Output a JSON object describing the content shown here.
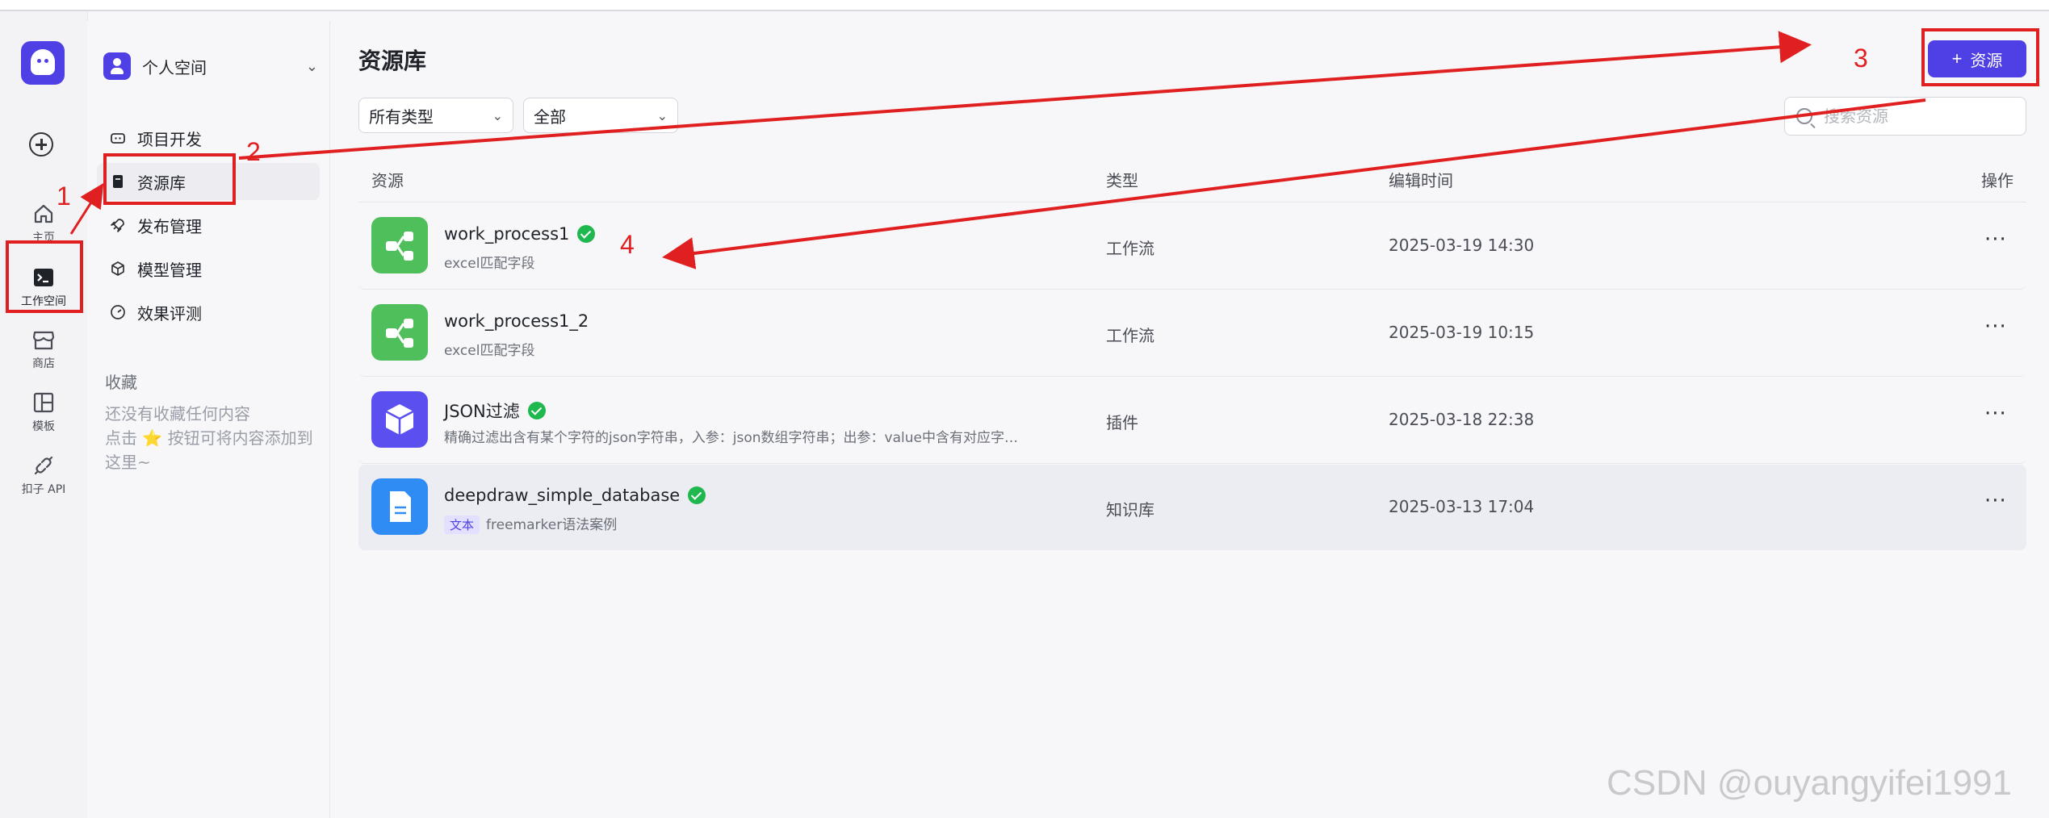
{
  "rail": {
    "home": "主页",
    "workspace": "工作空间",
    "store": "商店",
    "templates": "模板",
    "api": "扣子 API"
  },
  "sidebar": {
    "space_name": "个人空间",
    "items": [
      {
        "label": "项目开发",
        "icon": "robot-icon"
      },
      {
        "label": "资源库",
        "icon": "book-icon"
      },
      {
        "label": "发布管理",
        "icon": "rocket-icon"
      },
      {
        "label": "模型管理",
        "icon": "cube-icon"
      },
      {
        "label": "效果评测",
        "icon": "gauge-icon"
      }
    ],
    "favorites_title": "收藏",
    "favorites_empty_line1": "还没有收藏任何内容",
    "favorites_empty_line2": "点击 ⭐ 按钮可将内容添加到这里~"
  },
  "main": {
    "title": "资源库",
    "add_button": "资源",
    "filter_type": "所有类型",
    "filter_scope": "全部",
    "search_placeholder": "搜索资源",
    "columns": [
      "资源",
      "类型",
      "编辑时间",
      "操作"
    ],
    "rows": [
      {
        "name": "work_process1",
        "desc": "excel匹配字段",
        "type": "工作流",
        "time": "2025-03-19 14:30",
        "verified": true,
        "icon": "workflow-icon",
        "color": "#4fbf5b"
      },
      {
        "name": "work_process1_2",
        "desc": "excel匹配字段",
        "type": "工作流",
        "time": "2025-03-19 10:15",
        "verified": false,
        "icon": "workflow-icon",
        "color": "#4fbf5b"
      },
      {
        "name": "JSON过滤",
        "desc": "精确过滤出含有某个字符的json字符串，入参：json数组字符串；出参：value中含有对应字…",
        "type": "插件",
        "time": "2025-03-18 22:38",
        "verified": true,
        "icon": "plugin-cube-icon",
        "color": "#5b4ff0"
      },
      {
        "name": "deepdraw_simple_database",
        "tag": "文本",
        "desc": "freemarker语法案例",
        "type": "知识库",
        "time": "2025-03-13 17:04",
        "verified": true,
        "icon": "document-icon",
        "color": "#2f8cf5"
      }
    ],
    "more": "···"
  },
  "annotations": [
    "1",
    "2",
    "3",
    "4"
  ],
  "watermark": "CSDN @ouyangyifei1991",
  "colors": {
    "accent": "#4e40e5",
    "annotation": "#e02020",
    "verified": "#1fb84f"
  }
}
